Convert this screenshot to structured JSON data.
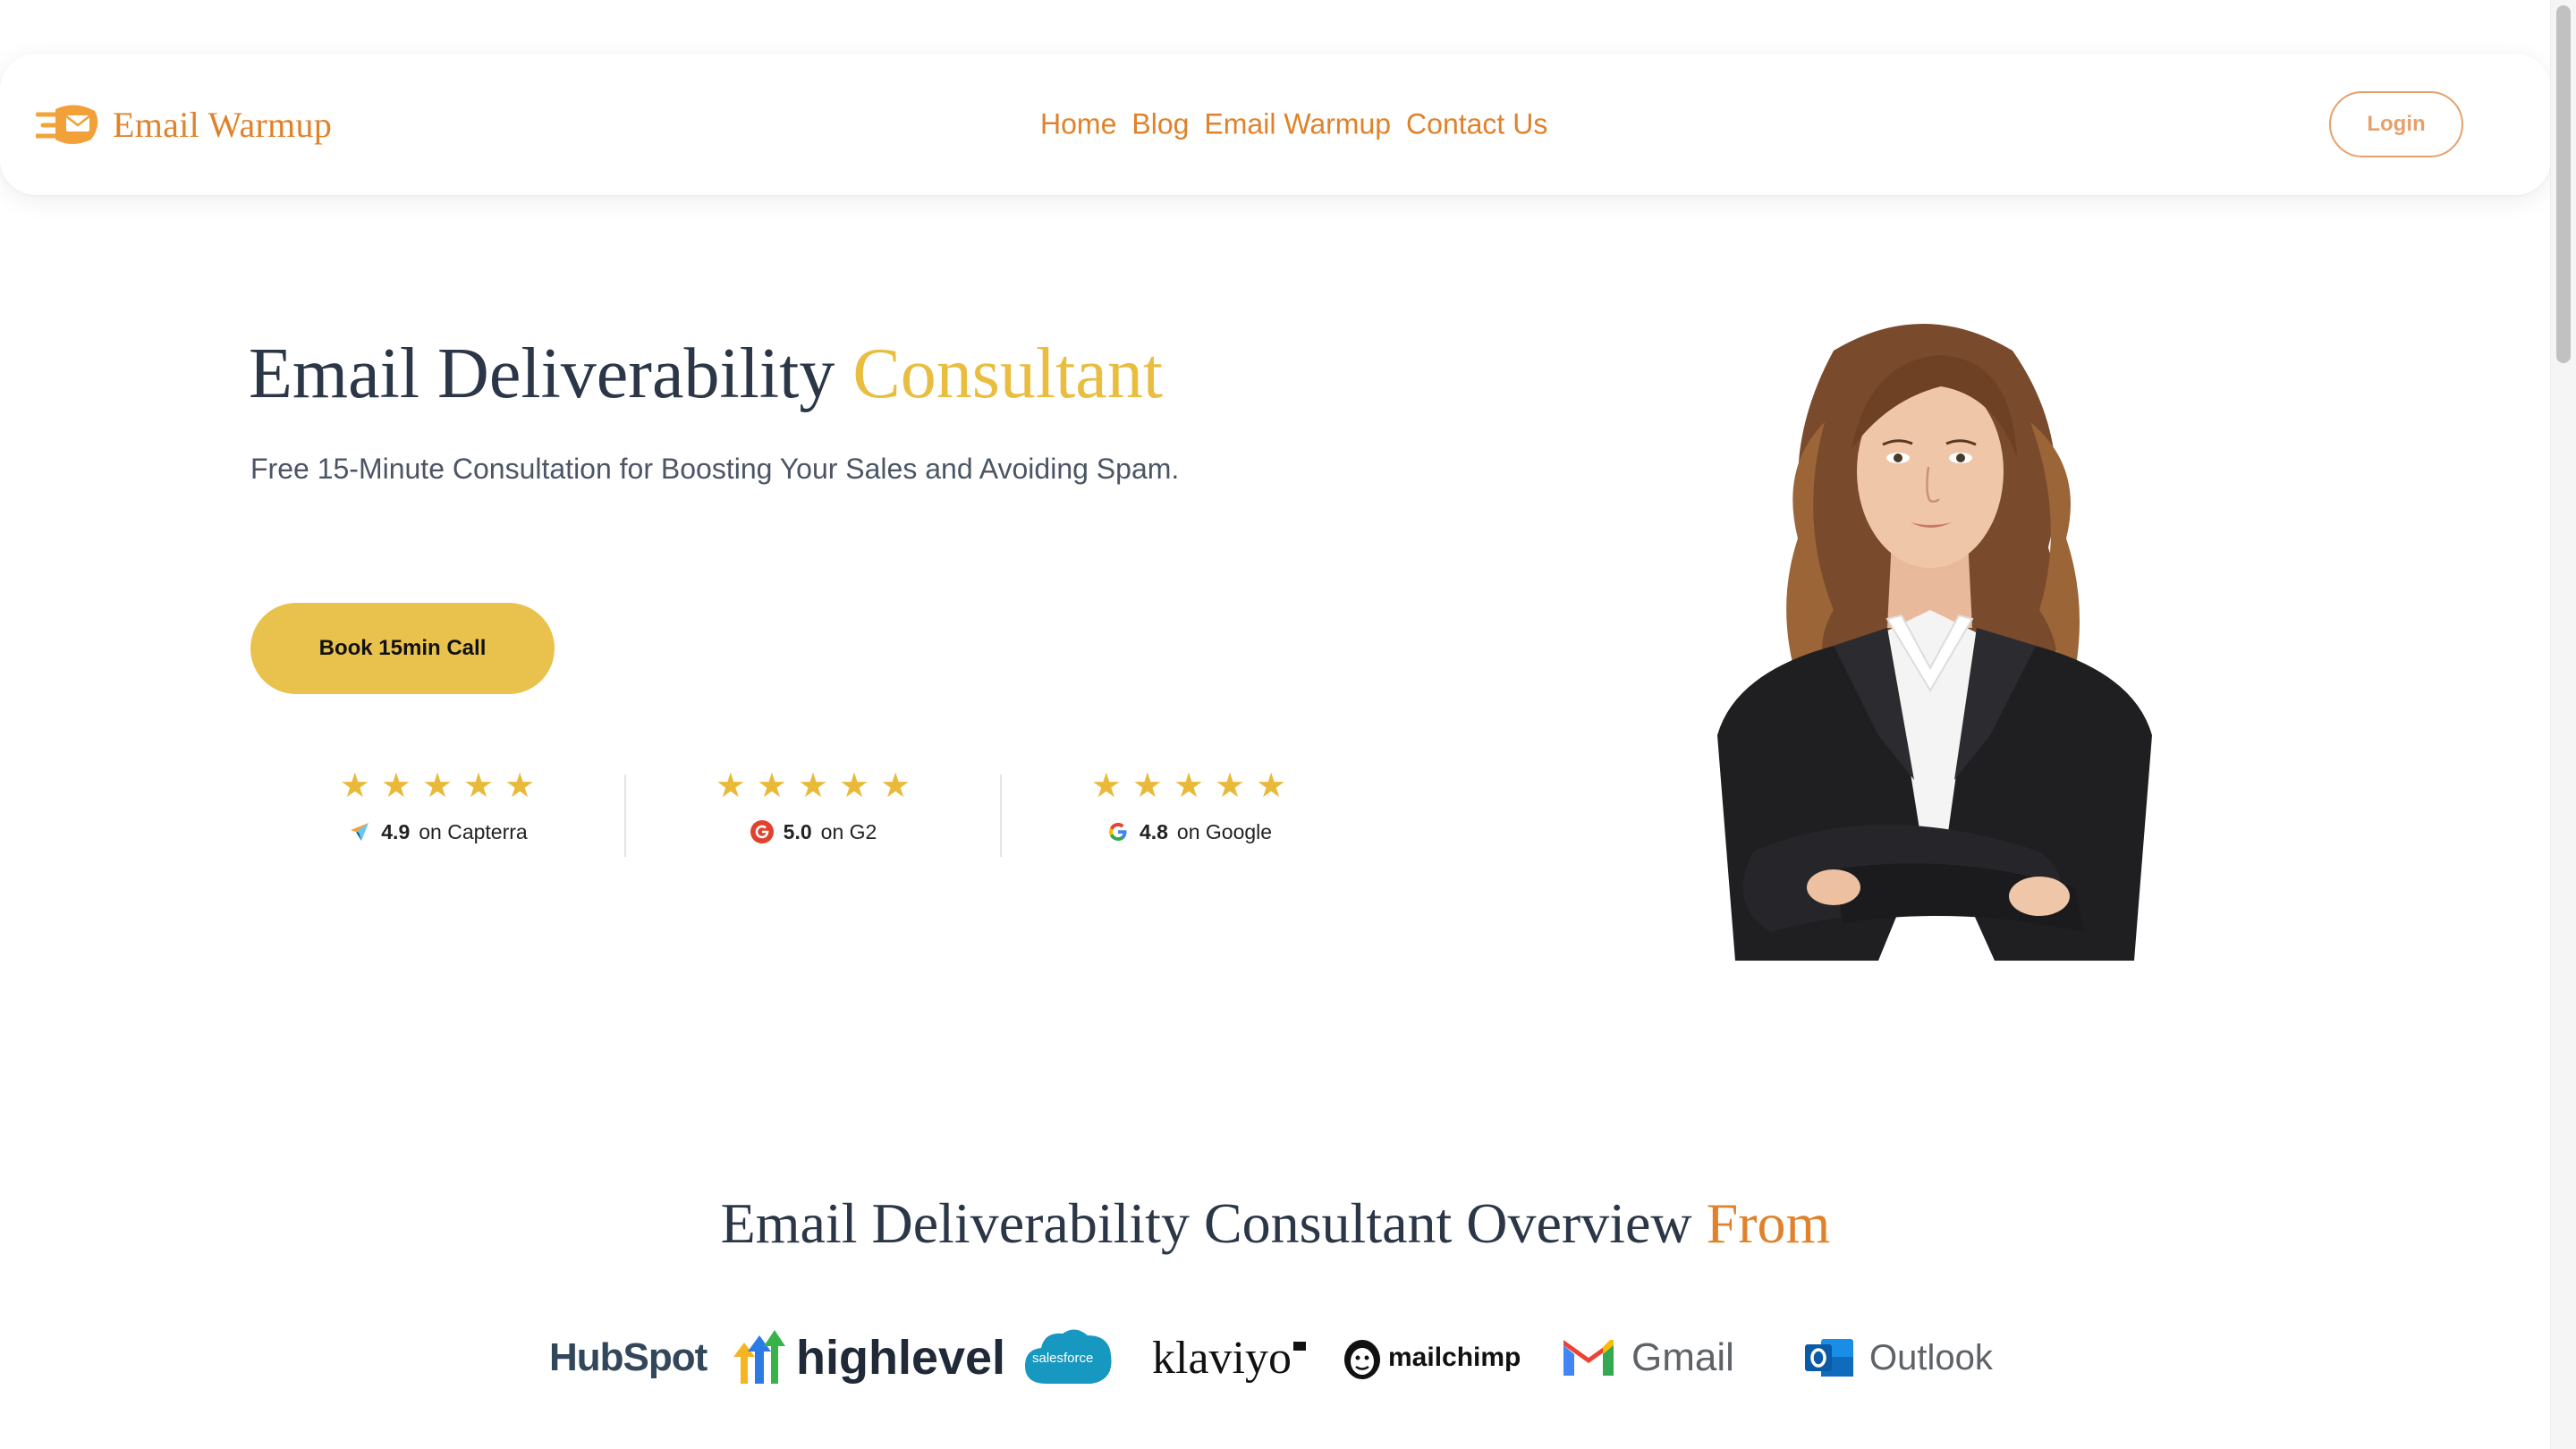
{
  "nav": {
    "brand": "Email Warmup",
    "links": [
      "Home",
      "Blog",
      "Email Warmup",
      "Contact Us"
    ],
    "login_label": "Login"
  },
  "hero": {
    "title_main": "Email Deliverability ",
    "title_accent": "Consultant",
    "subtitle": "Free 15-Minute Consultation for Boosting Your Sales and Avoiding Spam.",
    "cta_label": "Book 15min Call",
    "ratings": [
      {
        "score": "4.9",
        "source": "on Capterra",
        "stars": 5,
        "icon": "capterra-icon"
      },
      {
        "score": "5.0",
        "source": "on G2",
        "stars": 5,
        "icon": "g2-icon"
      },
      {
        "score": "4.8",
        "source": "on Google",
        "stars": 5,
        "icon": "google-icon"
      }
    ]
  },
  "overview": {
    "title_main": "Email Deliverability Consultant Overview ",
    "title_accent": "From",
    "logos": [
      "HubSpot",
      "highlevel",
      "salesforce",
      "klaviyo",
      "mailchimp",
      "Gmail",
      "Outlook"
    ]
  },
  "colors": {
    "brand_orange": "#e0822b",
    "accent_yellow": "#e9bd3e",
    "cta_yellow": "#e9c24d",
    "heading_navy": "#2b3647",
    "star_gold": "#e9b93a"
  }
}
